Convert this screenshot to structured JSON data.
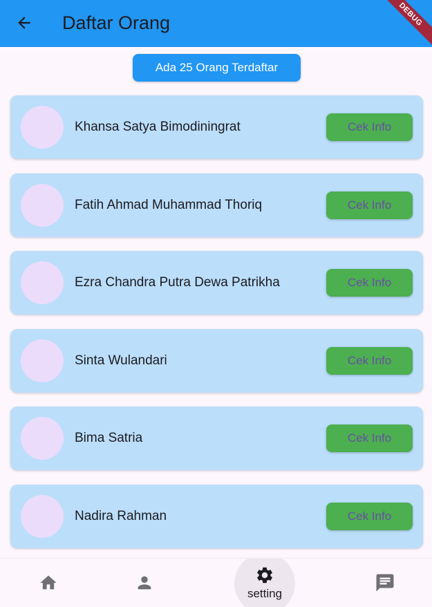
{
  "appbar": {
    "title": "Daftar Orang",
    "back_icon": "arrow-back-icon",
    "debug_label": "DEBUG"
  },
  "count_button": {
    "label": "Ada 25 Orang Terdaftar"
  },
  "people": [
    {
      "name": "Khansa Satya Bimodiningrat",
      "button": "Cek Info"
    },
    {
      "name": "Fatih Ahmad Muhammad Thoriq",
      "button": "Cek Info"
    },
    {
      "name": "Ezra Chandra Putra Dewa Patrikha",
      "button": "Cek Info"
    },
    {
      "name": "Sinta Wulandari",
      "button": "Cek Info"
    },
    {
      "name": "Bima Satria",
      "button": "Cek Info"
    },
    {
      "name": "Nadira Rahman",
      "button": "Cek Info"
    }
  ],
  "bottom_nav": {
    "items": [
      {
        "icon": "home-icon",
        "label": ""
      },
      {
        "icon": "person-icon",
        "label": ""
      },
      {
        "icon": "gear-icon",
        "label": "setting"
      },
      {
        "icon": "chat-icon",
        "label": ""
      }
    ],
    "selected_index": 2
  },
  "colors": {
    "primary": "#2196f3",
    "card": "#bbdefb",
    "info_button": "#4caf50",
    "info_text": "#6750a4",
    "avatar": "#ebdcfb"
  }
}
